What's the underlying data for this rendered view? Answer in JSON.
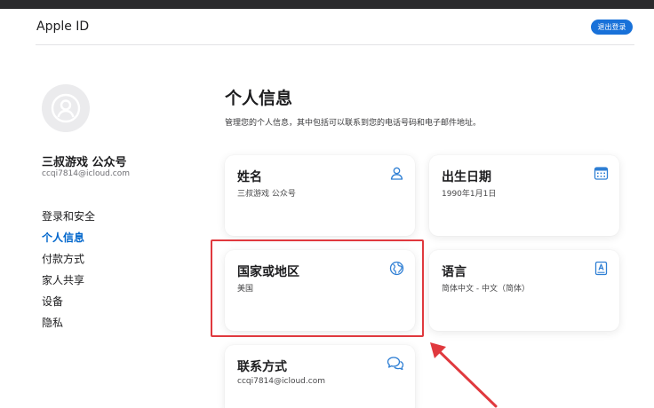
{
  "header": {
    "title": "Apple ID",
    "signout_label": "退出登录"
  },
  "sidebar": {
    "user_name": "三叔游戏 公众号",
    "user_email": "ccqi7814@icloud.com",
    "items": [
      {
        "label": "登录和安全",
        "active": false
      },
      {
        "label": "个人信息",
        "active": true
      },
      {
        "label": "付款方式",
        "active": false
      },
      {
        "label": "家人共享",
        "active": false
      },
      {
        "label": "设备",
        "active": false
      },
      {
        "label": "隐私",
        "active": false
      }
    ]
  },
  "main": {
    "title": "个人信息",
    "description": "管理您的个人信息，其中包括可以联系到您的电话号码和电子邮件地址。",
    "cards": [
      {
        "title": "姓名",
        "value": "三叔游戏 公众号",
        "icon": "person-icon"
      },
      {
        "title": "出生日期",
        "value": "1990年1月1日",
        "icon": "calendar-icon"
      },
      {
        "title": "国家或地区",
        "value": "美国",
        "icon": "globe-icon"
      },
      {
        "title": "语言",
        "value": "简体中文 - 中文（简体）",
        "icon": "language-book-icon"
      },
      {
        "title": "联系方式",
        "value": "ccqi7814@icloud.com",
        "icon": "chat-bubbles-icon"
      }
    ]
  },
  "colors": {
    "accent": "#0066cc",
    "button": "#1871d9",
    "icon": "#2f7fd4",
    "highlight": "#e0393e"
  }
}
